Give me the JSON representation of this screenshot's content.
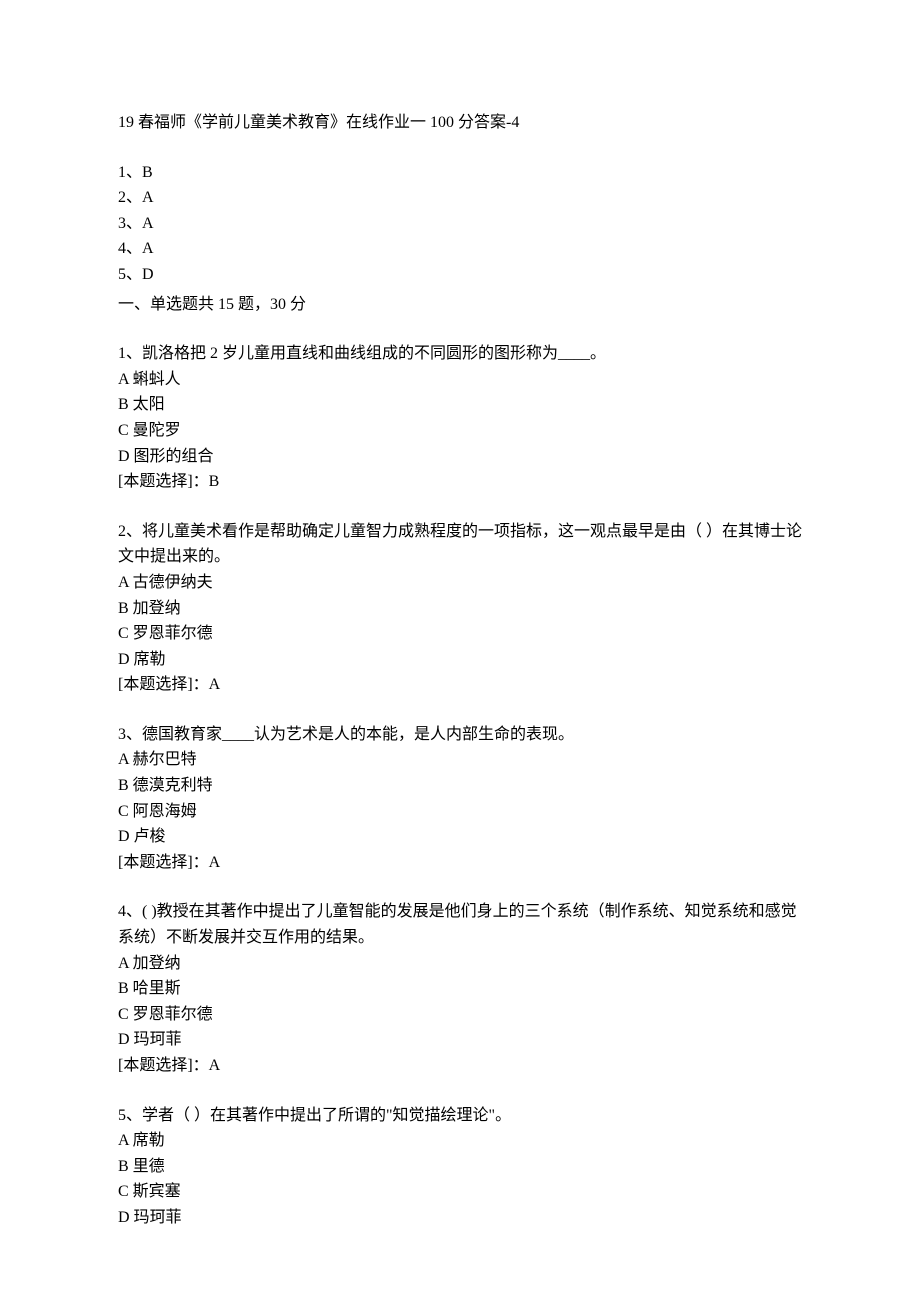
{
  "title": "19 春福师《学前儿童美术教育》在线作业一 100 分答案-4",
  "answer_key": [
    "1、B",
    "2、A",
    "3、A",
    "4、A",
    "5、D"
  ],
  "section_header": "一、单选题共 15 题，30 分",
  "questions": [
    {
      "stem": "1、凯洛格把 2 岁儿童用直线和曲线组成的不同圆形的图形称为____。",
      "options": [
        "A 蝌蚪人",
        "B 太阳",
        "C 曼陀罗",
        "D 图形的组合"
      ],
      "answer": "[本题选择]：B"
    },
    {
      "stem": "2、将儿童美术看作是帮助确定儿童智力成熟程度的一项指标，这一观点最早是由（ ）在其博士论文中提出来的。",
      "options": [
        "A 古德伊纳夫",
        "B 加登纳",
        "C 罗恩菲尔德",
        "D 席勒"
      ],
      "answer": "[本题选择]：A"
    },
    {
      "stem": "3、德国教育家____认为艺术是人的本能，是人内部生命的表现。",
      "options": [
        "A 赫尔巴特",
        "B 德漠克利特",
        "C 阿恩海姆",
        "D 卢梭"
      ],
      "answer": "[本题选择]：A"
    },
    {
      "stem": "4、( )教授在其著作中提出了儿童智能的发展是他们身上的三个系统（制作系统、知觉系统和感觉系统）不断发展并交互作用的结果。",
      "options": [
        "A 加登纳",
        "B 哈里斯",
        "C 罗恩菲尔德",
        "D 玛珂菲"
      ],
      "answer": "[本题选择]：A"
    },
    {
      "stem": "5、学者（ ）在其著作中提出了所谓的\"知觉描绘理论\"。",
      "options": [
        "A 席勒",
        "B 里德",
        "C 斯宾塞",
        "D 玛珂菲"
      ],
      "answer": ""
    }
  ]
}
